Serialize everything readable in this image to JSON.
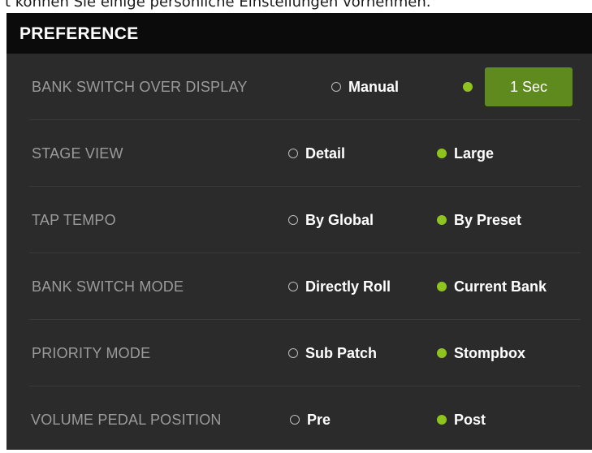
{
  "caption": "t können Sie einige persönliche Einstellungen vornehmen.",
  "panel": {
    "title": "PREFERENCE"
  },
  "accent_color": "#8fc31f",
  "rows": [
    {
      "label": "BANK SWITCH OVER DISPLAY",
      "option_a": "Manual",
      "option_b": "1 Sec",
      "selected": "option_b"
    },
    {
      "label": "STAGE VIEW",
      "option_a": "Detail",
      "option_b": "Large",
      "selected": "option_b"
    },
    {
      "label": "TAP TEMPO",
      "option_a": "By Global",
      "option_b": "By Preset",
      "selected": "option_b"
    },
    {
      "label": "BANK SWITCH MODE",
      "option_a": "Directly Roll",
      "option_b": "Current Bank",
      "selected": "option_b"
    },
    {
      "label": "PRIORITY MODE",
      "option_a": "Sub Patch",
      "option_b": "Stompbox",
      "selected": "option_b"
    },
    {
      "label": "VOLUME PEDAL POSITION",
      "option_a": "Pre",
      "option_b": "Post",
      "selected": "option_b"
    }
  ]
}
